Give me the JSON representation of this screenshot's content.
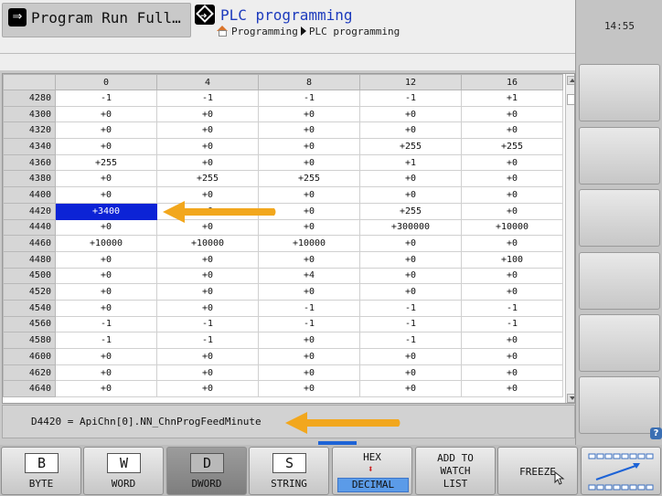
{
  "header": {
    "left_tab": "Program Run Full…",
    "title": "PLC programming",
    "breadcrumb": [
      "Programming",
      "PLC programming"
    ]
  },
  "clock": "14:55",
  "table": {
    "columns": [
      "0",
      "4",
      "8",
      "12",
      "16"
    ],
    "rows": [
      {
        "addr": "4280",
        "v": [
          "-1",
          "-1",
          "-1",
          "-1",
          "+1"
        ]
      },
      {
        "addr": "4300",
        "v": [
          "+0",
          "+0",
          "+0",
          "+0",
          "+0"
        ]
      },
      {
        "addr": "4320",
        "v": [
          "+0",
          "+0",
          "+0",
          "+0",
          "+0"
        ]
      },
      {
        "addr": "4340",
        "v": [
          "+0",
          "+0",
          "+0",
          "+255",
          "+255"
        ]
      },
      {
        "addr": "4360",
        "v": [
          "+255",
          "+0",
          "+0",
          "+1",
          "+0"
        ]
      },
      {
        "addr": "4380",
        "v": [
          "+0",
          "+255",
          "+255",
          "+0",
          "+0"
        ]
      },
      {
        "addr": "4400",
        "v": [
          "+0",
          "+0",
          "+0",
          "+0",
          "+0"
        ]
      },
      {
        "addr": "4420",
        "v": [
          "+3400",
          "+0",
          "+0",
          "+255",
          "+0"
        ]
      },
      {
        "addr": "4440",
        "v": [
          "+0",
          "+0",
          "+0",
          "+300000",
          "+10000"
        ]
      },
      {
        "addr": "4460",
        "v": [
          "+10000",
          "+10000",
          "+10000",
          "+0",
          "+0"
        ]
      },
      {
        "addr": "4480",
        "v": [
          "+0",
          "+0",
          "+0",
          "+0",
          "+100"
        ]
      },
      {
        "addr": "4500",
        "v": [
          "+0",
          "+0",
          "+4",
          "+0",
          "+0"
        ]
      },
      {
        "addr": "4520",
        "v": [
          "+0",
          "+0",
          "+0",
          "+0",
          "+0"
        ]
      },
      {
        "addr": "4540",
        "v": [
          "+0",
          "+0",
          "-1",
          "-1",
          "-1"
        ]
      },
      {
        "addr": "4560",
        "v": [
          "-1",
          "-1",
          "-1",
          "-1",
          "-1"
        ]
      },
      {
        "addr": "4580",
        "v": [
          "-1",
          "-1",
          "+0",
          "-1",
          "+0"
        ]
      },
      {
        "addr": "4600",
        "v": [
          "+0",
          "+0",
          "+0",
          "+0",
          "+0"
        ]
      },
      {
        "addr": "4620",
        "v": [
          "+0",
          "+0",
          "+0",
          "+0",
          "+0"
        ]
      },
      {
        "addr": "4640",
        "v": [
          "+0",
          "+0",
          "+0",
          "+0",
          "+0"
        ]
      }
    ],
    "selected": {
      "row": 7,
      "col": 0
    }
  },
  "status_line": "D4420 = ApiChn[0].NN_ChnProgFeedMinute",
  "softkeys": {
    "byte_key": "B",
    "byte_label": "BYTE",
    "word_key": "W",
    "word_label": "WORD",
    "dword_key": "D",
    "dword_label": "DWORD",
    "string_key": "S",
    "string_label": "STRING",
    "hex_label": "HEX",
    "decimal_label": "DECIMAL",
    "watch_line1": "ADD TO",
    "watch_line2": "WATCH",
    "watch_line3": "LIST",
    "freeze_label": "FREEZE"
  },
  "colors": {
    "selection": "#0c23d6",
    "arrow": "#f2a71d",
    "title": "#1d3bbd"
  }
}
